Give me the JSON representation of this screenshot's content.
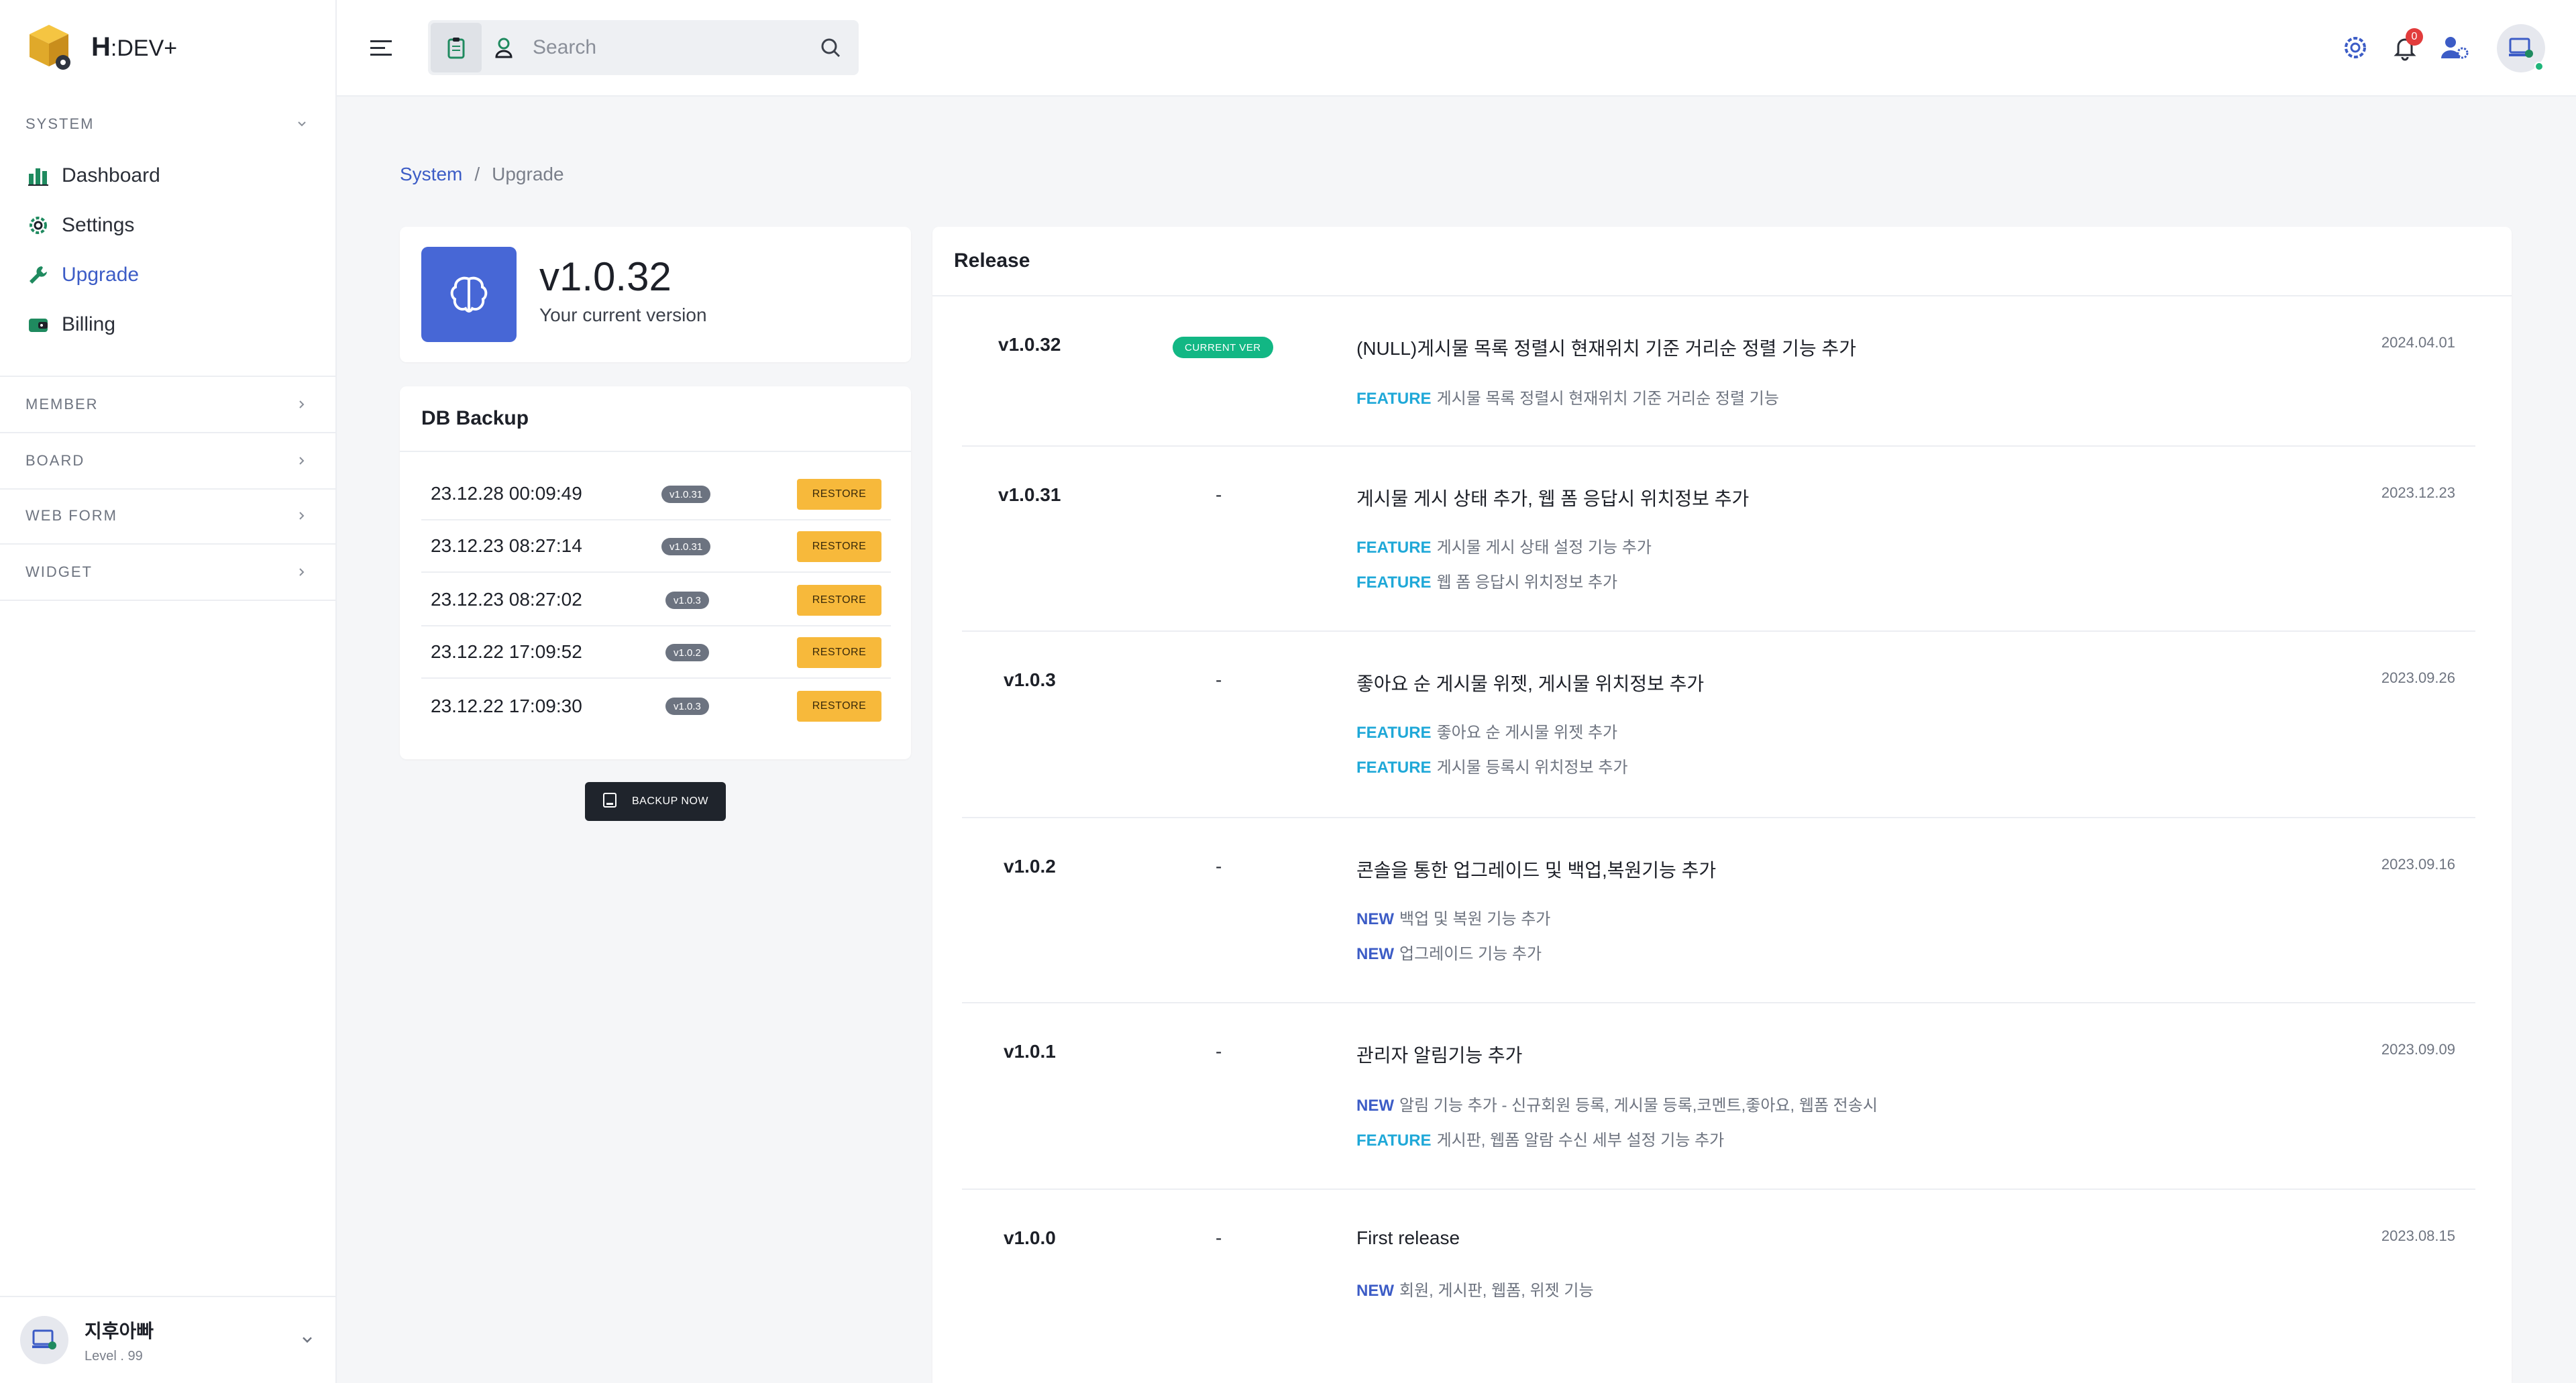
{
  "brand": {
    "prefix": "H",
    "suffix": ":DEV+"
  },
  "sidebar": {
    "system_label": "SYSTEM",
    "items": [
      {
        "label": "Dashboard",
        "icon": "chart-icon"
      },
      {
        "label": "Settings",
        "icon": "gear-icon"
      },
      {
        "label": "Upgrade",
        "icon": "wrench-icon",
        "active": true
      },
      {
        "label": "Billing",
        "icon": "wallet-icon"
      }
    ],
    "sections": [
      "MEMBER",
      "BOARD",
      "WEB FORM",
      "WIDGET"
    ],
    "profile": {
      "name": "지후아빠",
      "level": "Level . 99"
    }
  },
  "topbar": {
    "search_placeholder": "Search",
    "notifications_count": "0"
  },
  "breadcrumb": {
    "parent": "System",
    "separator": "/",
    "current": "Upgrade"
  },
  "version": {
    "number": "v1.0.32",
    "caption": "Your current version"
  },
  "backup": {
    "title": "DB Backup",
    "restore_label": "RESTORE",
    "backup_now_label": "BACKUP NOW",
    "rows": [
      {
        "date": "23.12.28 00:09:49",
        "version": "v1.0.31"
      },
      {
        "date": "23.12.23 08:27:14",
        "version": "v1.0.31"
      },
      {
        "date": "23.12.23 08:27:02",
        "version": "v1.0.3"
      },
      {
        "date": "23.12.22 17:09:52",
        "version": "v1.0.2"
      },
      {
        "date": "23.12.22 17:09:30",
        "version": "v1.0.3"
      }
    ]
  },
  "release": {
    "title": "Release",
    "current_badge": "CURRENT VER",
    "dash": "-",
    "entries": [
      {
        "version": "v1.0.32",
        "title": "(NULL)게시물 목록 정렬시 현재위치 기준 거리순 정렬 기능 추가",
        "date": "2024.04.01",
        "items": [
          {
            "tag": "FEATURE",
            "text": "게시물 목록 정렬시 현재위치 기준 거리순 정렬 기능"
          }
        ]
      },
      {
        "version": "v1.0.31",
        "title": "게시물 게시 상태 추가, 웹 폼 응답시 위치정보 추가",
        "date": "2023.12.23",
        "items": [
          {
            "tag": "FEATURE",
            "text": "게시물 게시 상태 설정 기능 추가"
          },
          {
            "tag": "FEATURE",
            "text": "웹 폼 응답시 위치정보 추가"
          }
        ]
      },
      {
        "version": "v1.0.3",
        "title": "좋아요 순 게시물 위젯, 게시물 위치정보 추가",
        "date": "2023.09.26",
        "items": [
          {
            "tag": "FEATURE",
            "text": "좋아요 순 게시물 위젯 추가"
          },
          {
            "tag": "FEATURE",
            "text": "게시물 등록시 위치정보 추가"
          }
        ]
      },
      {
        "version": "v1.0.2",
        "title": "콘솔을 통한 업그레이드 및 백업,복원기능 추가",
        "date": "2023.09.16",
        "items": [
          {
            "tag": "NEW",
            "text": "백업 및 복원 기능 추가"
          },
          {
            "tag": "NEW",
            "text": "업그레이드 기능 추가"
          }
        ]
      },
      {
        "version": "v1.0.1",
        "title": "관리자 알림기능 추가",
        "date": "2023.09.09",
        "items": [
          {
            "tag": "NEW",
            "text": "알림 기능 추가 - 신규회원 등록, 게시물 등록,코멘트,좋아요, 웹폼 전송시"
          },
          {
            "tag": "FEATURE",
            "text": "게시판, 웹폼 알람 수신 세부 설정 기능 추가"
          }
        ]
      },
      {
        "version": "v1.0.0",
        "title": "First release",
        "date": "2023.08.15",
        "items": [
          {
            "tag": "NEW",
            "text": "회원, 게시판, 웹폼, 위젯 기능"
          }
        ]
      }
    ]
  },
  "colors": {
    "accent": "#3c5cc6",
    "version_icon_bg": "#4767d6",
    "restore_button": "#f7b93b",
    "current_badge": "#12b784",
    "feature_tag": "#1fa8d8",
    "new_tag": "#3c5cc6",
    "backup_now_bg": "#1f242c",
    "notification_badge": "#e23c3c"
  }
}
